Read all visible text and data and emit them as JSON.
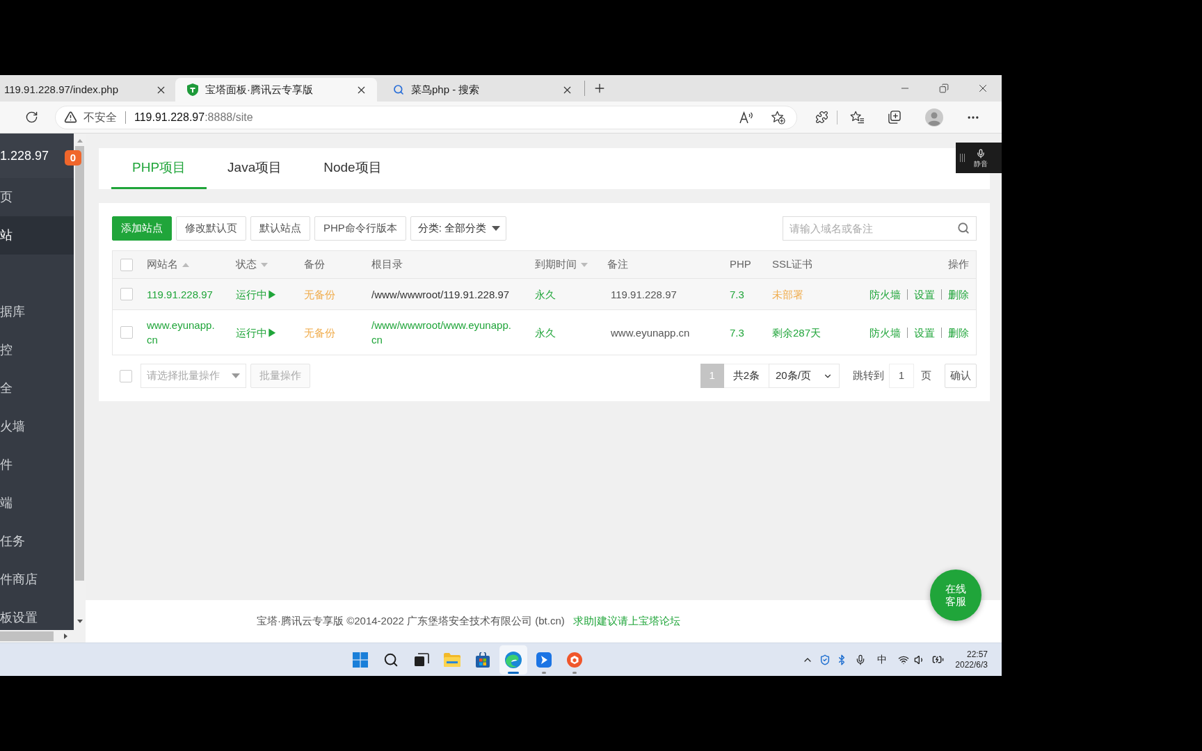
{
  "browser": {
    "tabs": [
      {
        "kind": "page",
        "title": "119.91.228.97/index.php",
        "selected": false
      },
      {
        "kind": "site",
        "title": "宝塔面板·腾讯云专享版",
        "selected": true
      },
      {
        "kind": "search",
        "title": "菜鸟php - 搜索",
        "selected": false
      }
    ],
    "address": {
      "security": "不安全",
      "host": "119.91.228.97",
      "path": ":8888/site"
    }
  },
  "sidebar": {
    "server": "1.228.97",
    "badge": "0",
    "items": [
      {
        "label": "页",
        "selected": false
      },
      {
        "label": "站",
        "selected": true
      },
      {
        "selected": false
      },
      {
        "label": "据库",
        "selected": false
      },
      {
        "label": "控",
        "selected": false
      },
      {
        "label": "全",
        "selected": false
      },
      {
        "label": "火墙",
        "selected": false
      },
      {
        "label": "件",
        "selected": false
      },
      {
        "label": "端",
        "selected": false
      },
      {
        "label": "任务",
        "selected": false
      },
      {
        "label": "件商店",
        "selected": false
      },
      {
        "label": "板设置",
        "selected": false
      }
    ]
  },
  "mic_widget": {
    "label": "静音"
  },
  "project_tabs": [
    {
      "label": "PHP项目",
      "selected": true
    },
    {
      "label": "Java项目",
      "selected": false
    },
    {
      "label": "Node项目",
      "selected": false
    }
  ],
  "toolbar": {
    "buttons": [
      {
        "kind": "primary",
        "label": "添加站点"
      },
      {
        "kind": "default",
        "label": "修改默认页"
      },
      {
        "kind": "default",
        "label": "默认站点"
      },
      {
        "kind": "default",
        "label": "PHP命令行版本"
      }
    ],
    "category": {
      "value": "分类: 全部分类"
    },
    "search": {
      "placeholder": "请输入域名或备注"
    }
  },
  "table": {
    "select_all": {
      "checked": false
    },
    "columns": [
      {
        "label": "网站名",
        "sortable": true,
        "ascending": true
      },
      {
        "label": "状态",
        "sortable": true,
        "ascending": false
      },
      {
        "label": "备份",
        "sortable": false
      },
      {
        "label": "根目录",
        "sortable": false
      },
      {
        "label": "到期时间",
        "sortable": true,
        "ascending": false
      },
      {
        "label": "备注",
        "sortable": false
      },
      {
        "label": "PHP",
        "sortable": false
      },
      {
        "label": "SSL证书",
        "sortable": false
      },
      {
        "label": "操作",
        "sortable": false
      }
    ],
    "rows": [
      {
        "checked": false,
        "hovered": true,
        "name": "119.91.228.97",
        "status": {
          "kind": "running",
          "text": "运行中▶"
        },
        "backup": {
          "kind": "missing",
          "text": "无备份"
        },
        "root": "/www/wwwroot/119.91.228.97",
        "expiry": "永久",
        "note": "119.91.228.97",
        "php": "7.3",
        "ssl": {
          "kind": "missing",
          "text": "未部署"
        },
        "actions": [
          "防火墙",
          "设置",
          "删除"
        ]
      },
      {
        "checked": false,
        "hovered": false,
        "name": "www.eyunapp.cn",
        "status": {
          "kind": "running",
          "text": "运行中▶"
        },
        "backup": {
          "kind": "missing",
          "text": "无备份"
        },
        "root": "/www/wwwroot/www.eyunapp.cn",
        "expiry": "永久",
        "note": "www.eyunapp.cn",
        "php": "7.3",
        "ssl": {
          "kind": "valid",
          "text": "剩余287天"
        },
        "actions": [
          "防火墙",
          "设置",
          "删除"
        ]
      }
    ]
  },
  "batch": {
    "checked": false,
    "placeholder": "请选择批量操作",
    "button": "批量操作",
    "disabled": true
  },
  "pagination": {
    "pages": [
      {
        "label": "1",
        "selected": true
      }
    ],
    "total": "共2条",
    "page_size": "20条/页",
    "jump_label": "跳转到",
    "jump_value": "1",
    "unit": "页",
    "confirm": "确认"
  },
  "footer": {
    "copyright": "宝塔·腾讯云专享版 ©2014-2022 广东堡塔安全技术有限公司 (bt.cn)",
    "link": "求助|建议请上宝塔论坛"
  },
  "chat_button": {
    "label": "在线客服"
  },
  "taskbar": {
    "apps": [
      {
        "kind": "start",
        "running": false,
        "active": false
      },
      {
        "kind": "search",
        "running": false,
        "active": false
      },
      {
        "kind": "taskview",
        "running": false,
        "active": false
      },
      {
        "kind": "files",
        "running": false,
        "active": false
      },
      {
        "kind": "store",
        "running": false,
        "active": false
      },
      {
        "kind": "browser",
        "running": true,
        "active": true
      },
      {
        "kind": "bluetile",
        "running": true,
        "active": false
      },
      {
        "kind": "orangecircle",
        "running": true,
        "active": false
      }
    ],
    "tray": {
      "input_method": "中",
      "time": "22:57",
      "date": "2022/6/3"
    }
  }
}
